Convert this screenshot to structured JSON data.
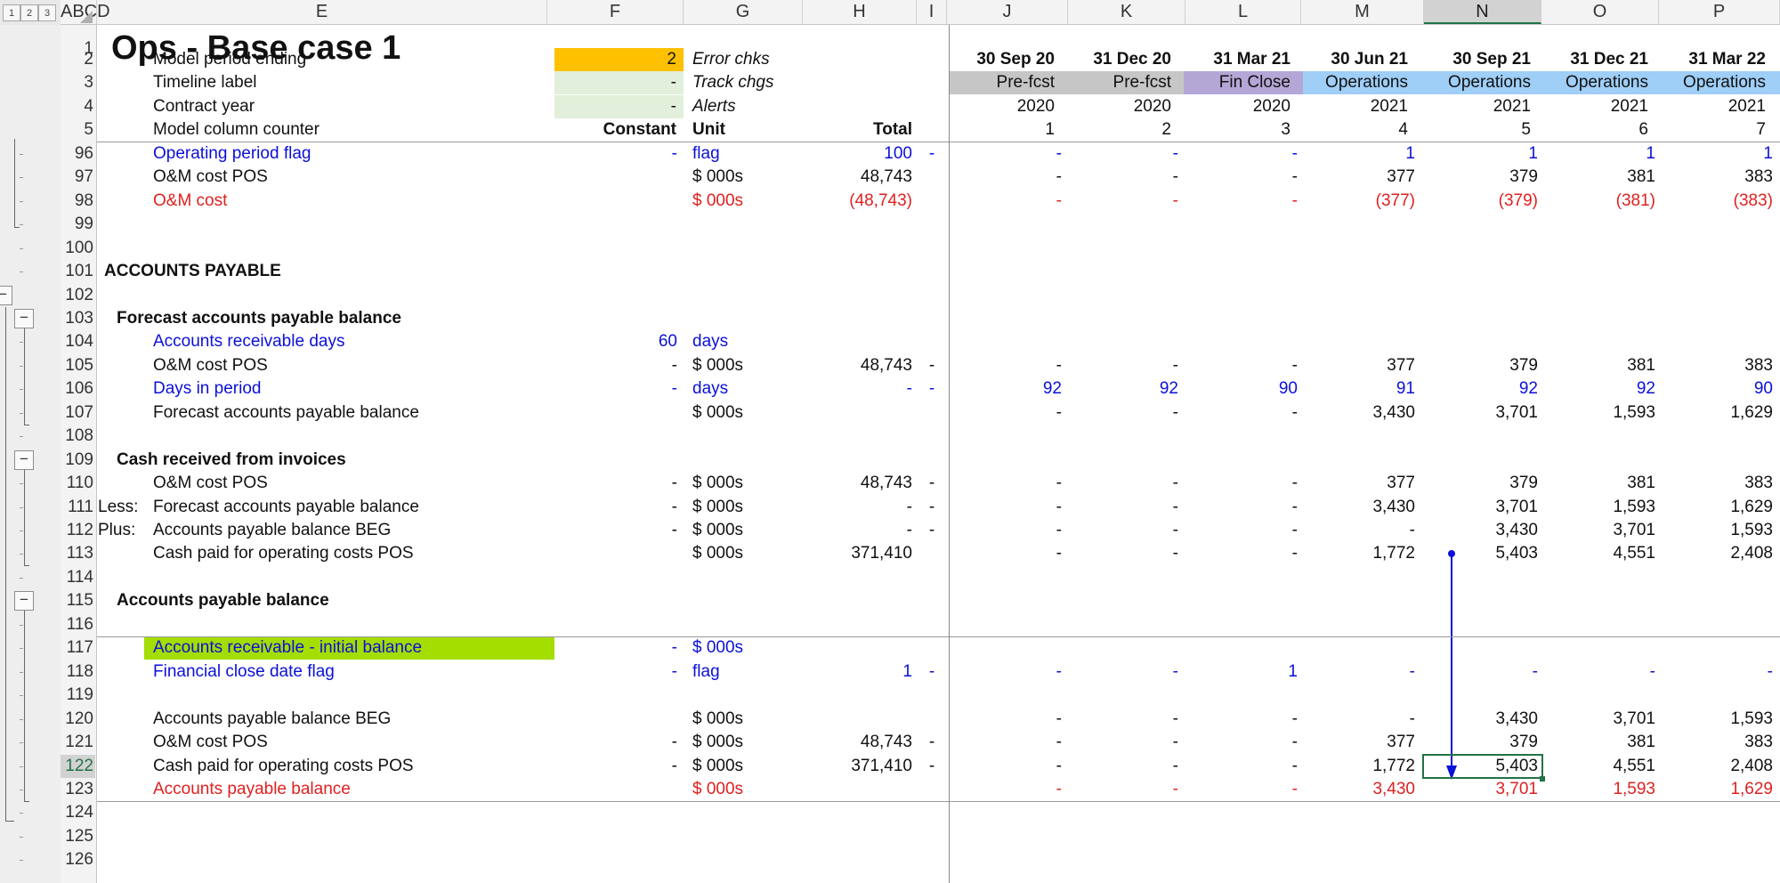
{
  "sheet": {
    "title": "Ops - Base case 1"
  },
  "outline": {
    "levels": [
      "1",
      "2",
      "3"
    ]
  },
  "columns": [
    "ABCD",
    "E",
    "F",
    "G",
    "H",
    "I",
    "J",
    "K",
    "L",
    "M",
    "N",
    "O",
    "P"
  ],
  "rows": [
    "1",
    "2",
    "3",
    "4",
    "5",
    "96",
    "97",
    "98",
    "99",
    "100",
    "101",
    "102",
    "103",
    "104",
    "105",
    "106",
    "107",
    "108",
    "109",
    "110",
    "111",
    "112",
    "113",
    "114",
    "115",
    "116",
    "117",
    "118",
    "119",
    "120",
    "121",
    "122",
    "123",
    "124",
    "125",
    "126"
  ],
  "header": {
    "labels": [
      "Model period ending",
      "Timeline label",
      "Contract year",
      "Model column counter"
    ],
    "f_values": [
      "2",
      "-",
      "-",
      "Constant"
    ],
    "g_values": [
      "Error chks",
      "Track chgs",
      "Alerts",
      "Unit"
    ],
    "total_label": "Total",
    "dates": [
      "30 Sep 20",
      "31 Dec 20",
      "31 Mar 21",
      "30 Jun 21",
      "30 Sep 21",
      "31 Dec 21",
      "31 Mar 22"
    ],
    "phases": [
      "Pre-fcst",
      "Pre-fcst",
      "Fin Close",
      "Operations",
      "Operations",
      "Operations",
      "Operations"
    ],
    "years": [
      "2020",
      "2020",
      "2020",
      "2021",
      "2021",
      "2021",
      "2021"
    ],
    "counters": [
      "1",
      "2",
      "3",
      "4",
      "5",
      "6",
      "7"
    ]
  },
  "colors": {
    "period_fill": "#ffc000",
    "input_fill": "#e2efda",
    "prefcst": "#c6c6c6",
    "finclose": "#b4a7d6",
    "operations": "#9fcef7",
    "highlight": "#a4dd00",
    "selection": "#217346",
    "precedent_arrow": "#0b10d8"
  },
  "data_rows": [
    {
      "row": "96",
      "pre": "",
      "label": "Operating period flag",
      "constant": "-",
      "unit": "flag",
      "total": "100",
      "i": "-",
      "vals": [
        "-",
        "-",
        "-",
        "1",
        "1",
        "1",
        "1"
      ],
      "style": "blue"
    },
    {
      "row": "97",
      "pre": "",
      "label": "O&M cost POS",
      "constant": "",
      "unit": "$ 000s",
      "total": "48,743",
      "i": "",
      "vals": [
        "-",
        "-",
        "-",
        "377",
        "379",
        "381",
        "383"
      ],
      "style": "black"
    },
    {
      "row": "98",
      "pre": "",
      "label": "O&M cost",
      "constant": "",
      "unit": "$ 000s",
      "total": "(48,743)",
      "i": "",
      "vals": [
        "-",
        "-",
        "-",
        "(377)",
        "(379)",
        "(381)",
        "(383)"
      ],
      "style": "red"
    },
    {
      "row": "101",
      "pre": "",
      "label": "ACCOUNTS PAYABLE",
      "constant": "",
      "unit": "",
      "total": "",
      "i": "",
      "vals": [
        "",
        "",
        "",
        "",
        "",
        "",
        ""
      ],
      "style": "section"
    },
    {
      "row": "103",
      "pre": "",
      "label": "Forecast accounts payable balance",
      "constant": "",
      "unit": "",
      "total": "",
      "i": "",
      "vals": [
        "",
        "",
        "",
        "",
        "",
        "",
        ""
      ],
      "style": "sub"
    },
    {
      "row": "104",
      "pre": "",
      "label": "Accounts receivable days",
      "constant": "60",
      "unit": "days",
      "total": "",
      "i": "",
      "vals": [
        "",
        "",
        "",
        "",
        "",
        "",
        ""
      ],
      "style": "blue"
    },
    {
      "row": "105",
      "pre": "",
      "label": "O&M cost POS",
      "constant": "-",
      "unit": "$ 000s",
      "total": "48,743",
      "i": "-",
      "vals": [
        "-",
        "-",
        "-",
        "377",
        "379",
        "381",
        "383"
      ],
      "style": "black"
    },
    {
      "row": "106",
      "pre": "",
      "label": "Days in period",
      "constant": "-",
      "unit": "days",
      "total": "-",
      "i": "-",
      "vals": [
        "92",
        "92",
        "90",
        "91",
        "92",
        "92",
        "90"
      ],
      "style": "blue"
    },
    {
      "row": "107",
      "pre": "",
      "label": "Forecast accounts payable balance",
      "constant": "",
      "unit": "$ 000s",
      "total": "",
      "i": "",
      "vals": [
        "-",
        "-",
        "-",
        "3,430",
        "3,701",
        "1,593",
        "1,629"
      ],
      "style": "black"
    },
    {
      "row": "109",
      "pre": "",
      "label": "Cash received from invoices",
      "constant": "",
      "unit": "",
      "total": "",
      "i": "",
      "vals": [
        "",
        "",
        "",
        "",
        "",
        "",
        ""
      ],
      "style": "sub"
    },
    {
      "row": "110",
      "pre": "",
      "label": "O&M cost POS",
      "constant": "-",
      "unit": "$ 000s",
      "total": "48,743",
      "i": "-",
      "vals": [
        "-",
        "-",
        "-",
        "377",
        "379",
        "381",
        "383"
      ],
      "style": "black"
    },
    {
      "row": "111",
      "pre": "Less:",
      "label": "Forecast accounts payable balance",
      "constant": "-",
      "unit": "$ 000s",
      "total": "-",
      "i": "-",
      "vals": [
        "-",
        "-",
        "-",
        "3,430",
        "3,701",
        "1,593",
        "1,629"
      ],
      "style": "black"
    },
    {
      "row": "112",
      "pre": "Plus:",
      "label": "Accounts payable balance BEG",
      "constant": "-",
      "unit": "$ 000s",
      "total": "-",
      "i": "-",
      "vals": [
        "-",
        "-",
        "-",
        "-",
        "3,430",
        "3,701",
        "1,593"
      ],
      "style": "black"
    },
    {
      "row": "113",
      "pre": "",
      "label": "Cash paid for operating costs POS",
      "constant": "",
      "unit": "$ 000s",
      "total": "371,410",
      "i": "",
      "vals": [
        "-",
        "-",
        "-",
        "1,772",
        "5,403",
        "4,551",
        "2,408"
      ],
      "style": "black"
    },
    {
      "row": "115",
      "pre": "",
      "label": "Accounts payable balance",
      "constant": "",
      "unit": "",
      "total": "",
      "i": "",
      "vals": [
        "",
        "",
        "",
        "",
        "",
        "",
        ""
      ],
      "style": "sub"
    },
    {
      "row": "117",
      "pre": "",
      "label": "Accounts receivable - initial balance",
      "constant": "-",
      "unit": "$ 000s",
      "total": "",
      "i": "",
      "vals": [
        "",
        "",
        "",
        "",
        "",
        "",
        ""
      ],
      "style": "bluehl"
    },
    {
      "row": "118",
      "pre": "",
      "label": "Financial close date flag",
      "constant": "-",
      "unit": "flag",
      "total": "1",
      "i": "-",
      "vals": [
        "-",
        "-",
        "1",
        "-",
        "-",
        "-",
        "-"
      ],
      "style": "blue"
    },
    {
      "row": "120",
      "pre": "",
      "label": "Accounts payable balance BEG",
      "constant": "",
      "unit": "$ 000s",
      "total": "",
      "i": "",
      "vals": [
        "-",
        "-",
        "-",
        "-",
        "3,430",
        "3,701",
        "1,593"
      ],
      "style": "black"
    },
    {
      "row": "121",
      "pre": "",
      "label": "O&M cost POS",
      "constant": "-",
      "unit": "$ 000s",
      "total": "48,743",
      "i": "-",
      "vals": [
        "-",
        "-",
        "-",
        "377",
        "379",
        "381",
        "383"
      ],
      "style": "black"
    },
    {
      "row": "122",
      "pre": "",
      "label": "Cash paid for operating costs POS",
      "constant": "-",
      "unit": "$ 000s",
      "total": "371,410",
      "i": "-",
      "vals": [
        "-",
        "-",
        "-",
        "1,772",
        "5,403",
        "4,551",
        "2,408"
      ],
      "style": "black"
    },
    {
      "row": "123",
      "pre": "",
      "label": "Accounts payable balance",
      "constant": "",
      "unit": "$ 000s",
      "total": "",
      "i": "",
      "vals": [
        "-",
        "-",
        "-",
        "3,430",
        "3,701",
        "1,593",
        "1,629"
      ],
      "style": "red"
    }
  ]
}
